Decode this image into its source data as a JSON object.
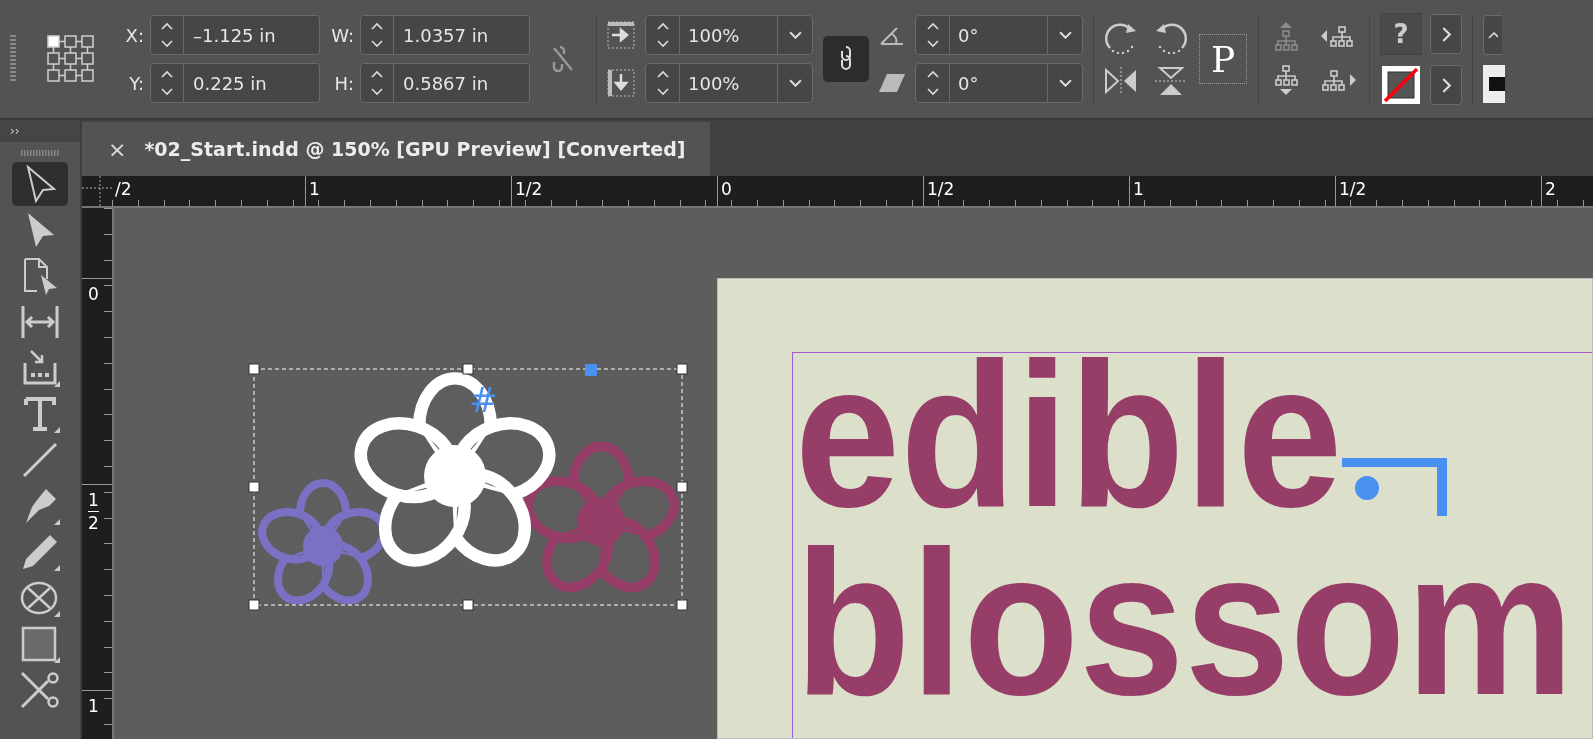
{
  "control_bar": {
    "position_fields": [
      {
        "label": "X:",
        "value": "–1.125 in"
      },
      {
        "label": "Y:",
        "value": "0.225 in"
      }
    ],
    "size_fields": [
      {
        "label": "W:",
        "value": "1.0357 in"
      },
      {
        "label": "H:",
        "value": "0.5867 in"
      }
    ],
    "size_link": {
      "on": false
    },
    "scale_fields": [
      {
        "kind": "horizontal",
        "value": "100%"
      },
      {
        "kind": "vertical",
        "value": "100%"
      }
    ],
    "scale_link": {
      "on": true
    },
    "angle_fields": [
      {
        "kind": "rotation",
        "value": "0°"
      },
      {
        "kind": "shear",
        "value": "0°"
      }
    ],
    "text_frame_button": "P",
    "help_button": "?"
  },
  "tools_panel": {
    "collapse": "››",
    "tools": [
      {
        "kind": "selection",
        "selected": true,
        "flyout": false
      },
      {
        "kind": "direct-selection",
        "selected": false,
        "flyout": false
      },
      {
        "kind": "page",
        "selected": false,
        "flyout": false
      },
      {
        "kind": "gap",
        "selected": false,
        "flyout": false
      },
      {
        "kind": "content-collector",
        "selected": false,
        "flyout": true
      },
      {
        "kind": "type",
        "selected": false,
        "flyout": true
      },
      {
        "kind": "line",
        "selected": false,
        "flyout": false
      },
      {
        "kind": "pen",
        "selected": false,
        "flyout": true
      },
      {
        "kind": "pencil",
        "selected": false,
        "flyout": true
      },
      {
        "kind": "ellipse-frame",
        "selected": false,
        "flyout": true
      },
      {
        "kind": "rectangle",
        "selected": false,
        "flyout": true
      },
      {
        "kind": "scissors",
        "selected": false,
        "flyout": false
      }
    ]
  },
  "document_tab": {
    "close": "×",
    "title": "*02_Start.indd @ 150% [GPU Preview] [Converted]"
  },
  "horizontal_ruler": [
    "/2",
    "1",
    "1/2",
    "0",
    "1/2",
    "1",
    "1/2",
    "2"
  ],
  "vertical_ruler": [
    {
      "lines": [
        "0"
      ]
    },
    {
      "lines": [
        "1",
        "2"
      ]
    },
    {
      "lines": [
        "1"
      ]
    }
  ],
  "canvas": {
    "frame_marker": "#",
    "page_lines": [
      "edible",
      "blossom"
    ]
  }
}
